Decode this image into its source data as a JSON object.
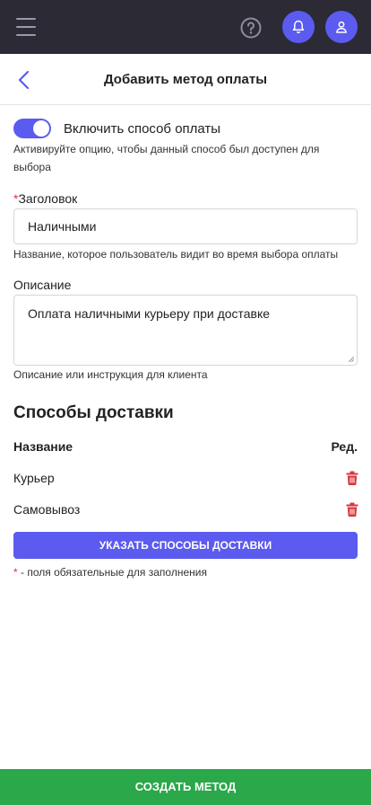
{
  "topbar": {
    "menu_icon": "hamburger-icon",
    "help_icon": "help-circle-icon",
    "bell_icon": "bell-icon",
    "user_icon": "user-icon",
    "accent": "#5b5bef",
    "background": "#2b2a35"
  },
  "header": {
    "back_icon": "chevron-left-icon",
    "title": "Добавить метод оплаты"
  },
  "form": {
    "toggle": {
      "label": "Включить способ оплаты",
      "enabled": true,
      "hint": "Активируйте опцию, чтобы данный способ был доступен для выбора"
    },
    "title_field": {
      "required_mark": "*",
      "label": "Заголовок",
      "value": "Наличными",
      "hint": "Название, которое пользователь видит во время выбора оплаты"
    },
    "description_field": {
      "label": "Описание",
      "value": "Оплата наличными курьеру при доставке",
      "hint": "Описание или инструкция для клиента"
    }
  },
  "delivery": {
    "section_title": "Способы доставки",
    "columns": {
      "name": "Название",
      "edit": "Ред."
    },
    "rows": [
      {
        "name": "Курьер",
        "action_icon": "trash-icon"
      },
      {
        "name": "Самовывоз",
        "action_icon": "trash-icon"
      }
    ],
    "button_label": "УКАЗАТЬ СПОСОБЫ ДОСТАВКИ"
  },
  "required_note": {
    "star": "*",
    "text": " - поля обязательные для заполнения"
  },
  "footer": {
    "button_label": "СОЗДАТЬ МЕТОД",
    "color": "#2aa84a"
  }
}
